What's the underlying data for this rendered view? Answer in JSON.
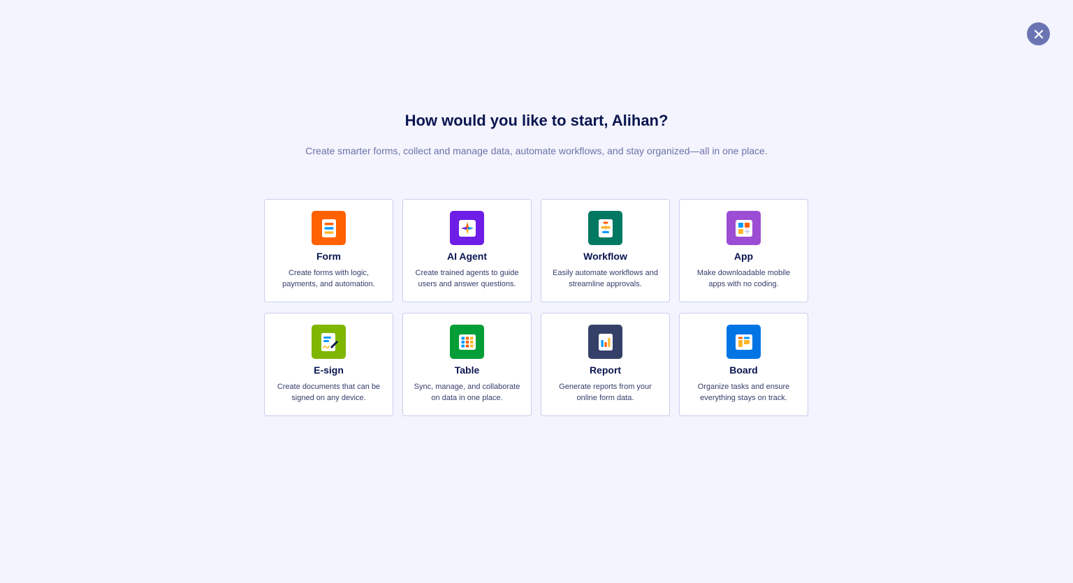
{
  "header": {
    "title": "How would you like to start, Alihan?",
    "subtitle": "Create smarter forms, collect and manage data, automate workflows, and stay organized—all in one place."
  },
  "close": {
    "icon": "close-icon",
    "color": "#6b74b3"
  },
  "cards": [
    {
      "id": "form",
      "title": "Form",
      "desc_line1": "Create forms with logic,",
      "desc_line2": "payments, and automation.",
      "icon": "form-icon",
      "color": "#ff6100"
    },
    {
      "id": "ai-agent",
      "title": "AI Agent",
      "desc_line1": "Create trained agents to guide",
      "desc_line2": "users and answer questions.",
      "icon": "ai-agent-icon",
      "color": "#6e1ee6"
    },
    {
      "id": "workflow",
      "title": "Workflow",
      "desc_line1": "Easily automate workflows and",
      "desc_line2": "streamline approvals.",
      "icon": "workflow-icon",
      "color": "#007862"
    },
    {
      "id": "app",
      "title": "App",
      "desc_line1": "Make downloadable mobile",
      "desc_line2": "apps with no coding.",
      "icon": "app-icon",
      "color": "#9c4dd3"
    },
    {
      "id": "e-sign",
      "title": "E-sign",
      "desc_line1": "Create documents that can be",
      "desc_line2": "signed on any device.",
      "icon": "e-sign-icon",
      "color": "#7fb600"
    },
    {
      "id": "table",
      "title": "Table",
      "desc_line1": "Sync, manage, and collaborate",
      "desc_line2": "on data in one place.",
      "icon": "table-icon",
      "color": "#049e38"
    },
    {
      "id": "report",
      "title": "Report",
      "desc_line1": "Generate reports from your",
      "desc_line2": "online form data.",
      "icon": "report-icon",
      "color": "#344067"
    },
    {
      "id": "board",
      "title": "Board",
      "desc_line1": "Organize tasks and ensure",
      "desc_line2": "everything stays on track.",
      "icon": "board-icon",
      "color": "#0075e3"
    }
  ]
}
